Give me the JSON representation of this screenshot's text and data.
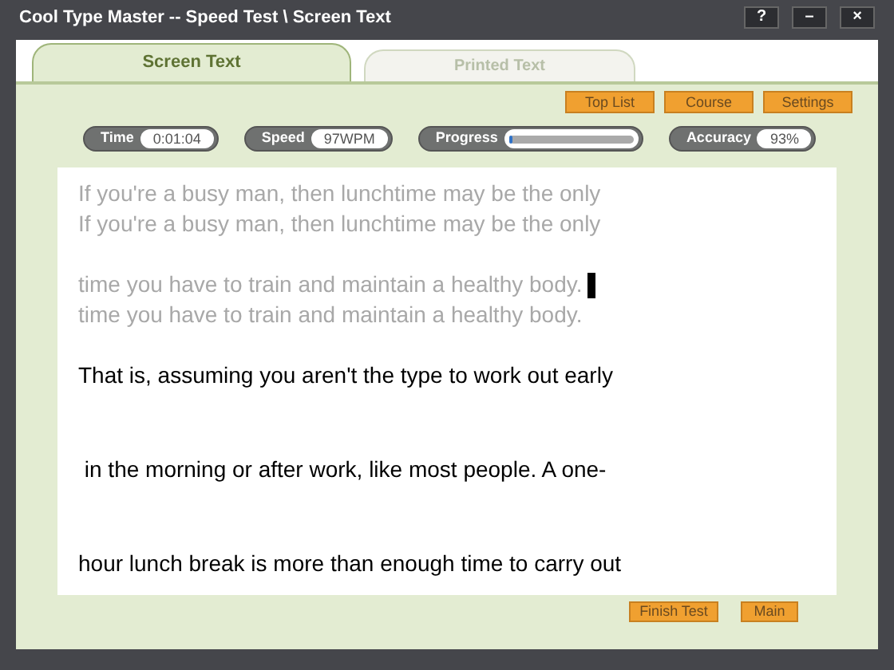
{
  "window": {
    "title": "Cool Type Master -- Speed Test \\ Screen Text",
    "controls": [
      "?",
      "–",
      "×"
    ]
  },
  "tabs": [
    {
      "label": "Screen Text",
      "selected": true
    },
    {
      "label": "Printed Text",
      "selected": false
    }
  ],
  "top_buttons": [
    "Top List",
    "Course",
    "Settings"
  ],
  "stats": [
    {
      "kind": "text",
      "label": "Time",
      "value": "0:01:04"
    },
    {
      "kind": "text",
      "label": "Speed",
      "value": "97WPM"
    },
    {
      "kind": "meter",
      "label": "Progress",
      "level": 0.03
    },
    {
      "kind": "text",
      "label": "Accuracy",
      "value": "93%"
    }
  ],
  "lines": [
    {
      "kind": "done",
      "text": "If you're a busy man, then lunchtime may be the only",
      "typed": "If you're a busy man, then lunchtime may be the only",
      "cursor": false
    },
    {
      "kind": "done",
      "text": "time you have to train and maintain a healthy body.",
      "typed": "time you have to train and maintain a healthy body.",
      "cursor": true
    },
    {
      "kind": "pending",
      "text": "That is, assuming you aren't the type to work out early"
    },
    {
      "kind": "pending",
      "text": " in the morning or after work, like most people. A one-"
    },
    {
      "kind": "pending",
      "text": "hour lunch break is more than enough time to carry out"
    }
  ],
  "bottom_buttons": [
    "Finish Test",
    "Main"
  ]
}
